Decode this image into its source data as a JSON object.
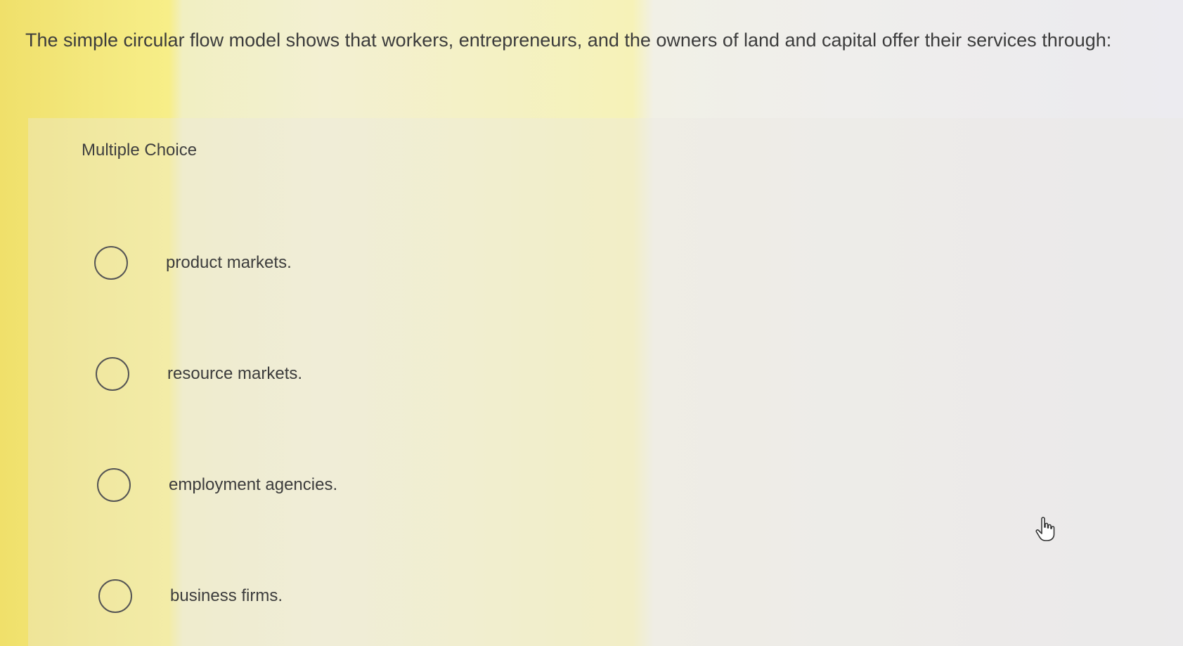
{
  "question": {
    "text": "The simple circular flow model shows that workers, entrepreneurs, and the owners of land and capital offer their services through:"
  },
  "answer_type": {
    "label": "Multiple Choice"
  },
  "options": [
    {
      "label": "product markets.",
      "selected": false
    },
    {
      "label": "resource markets.",
      "selected": false
    },
    {
      "label": "employment agencies.",
      "selected": false
    },
    {
      "label": "business firms.",
      "selected": false
    }
  ],
  "cursor": {
    "icon": "hand-pointer-icon"
  }
}
